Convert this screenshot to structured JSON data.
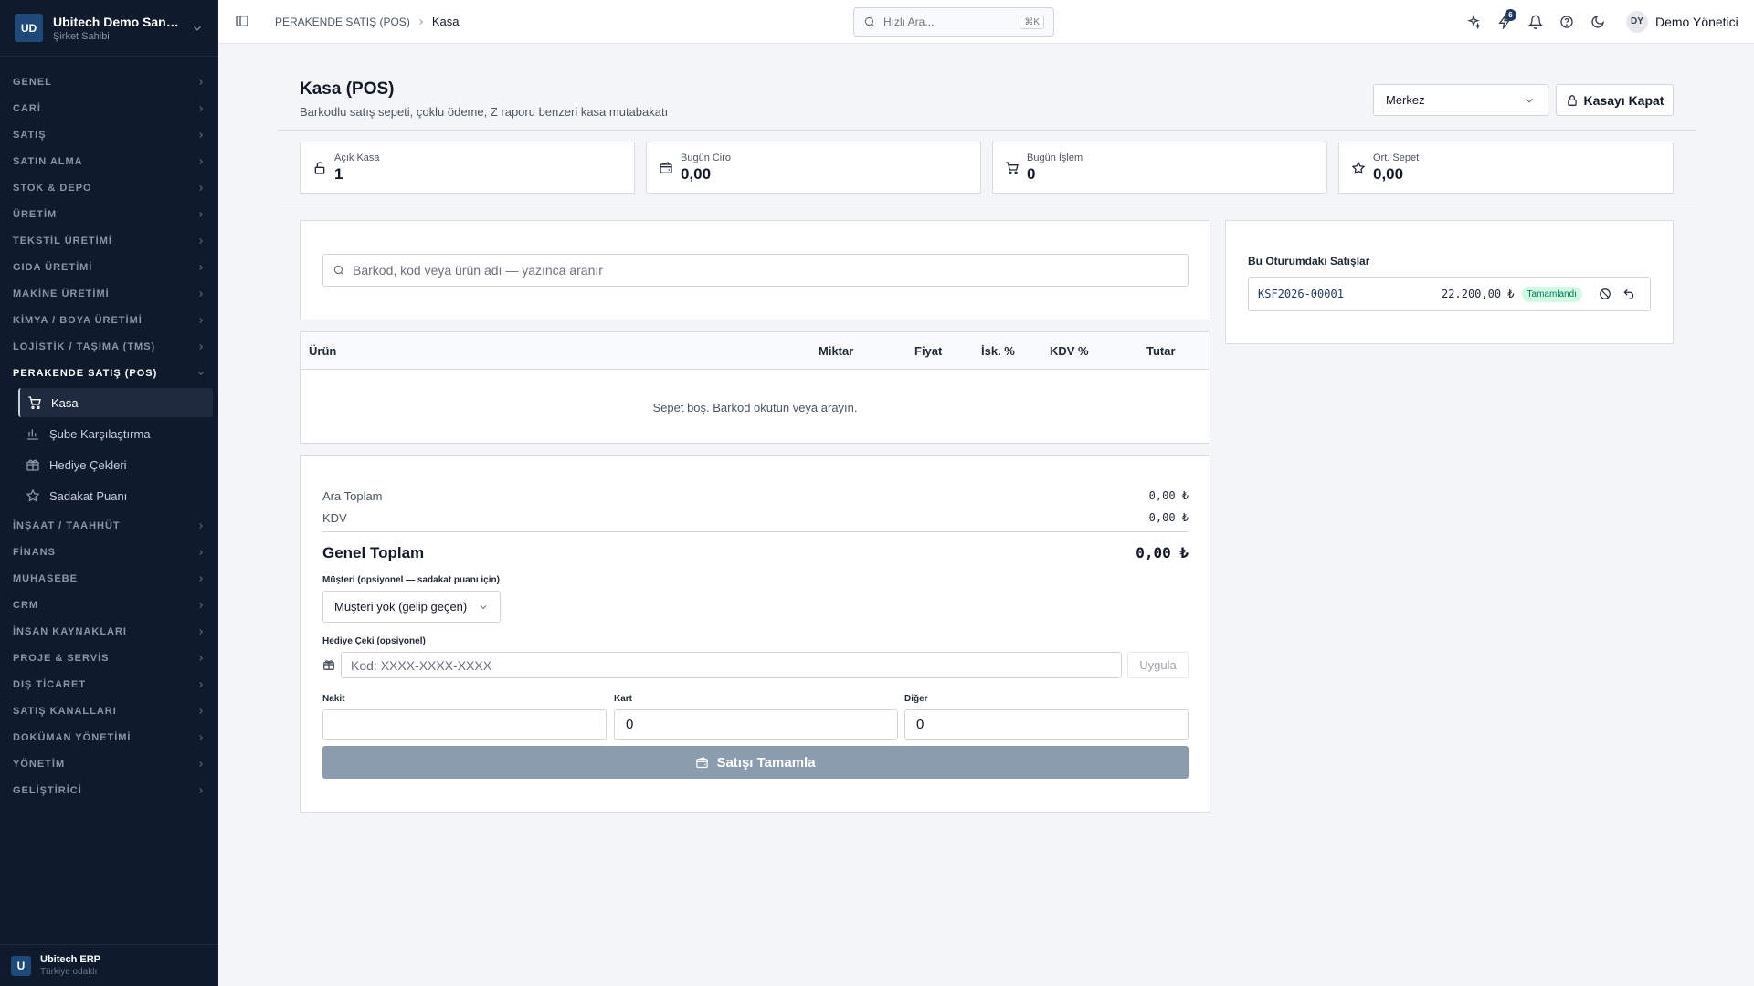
{
  "org": {
    "initials": "UD",
    "name": "Ubitech Demo Sana...",
    "role": "Şirket Sahibi"
  },
  "nav_before": [
    "GENEL",
    "CARİ",
    "SATIŞ",
    "SATIN ALMA",
    "STOK & DEPO",
    "ÜRETİM",
    "TEKSTİL ÜRETİMİ",
    "GIDA ÜRETİMİ",
    "MAKİNE ÜRETİMİ",
    "KİMYA / BOYA ÜRETİMİ",
    "LOJİSTİK / TAŞIMA (TMS)"
  ],
  "nav_open": "PERAKENDE SATIŞ (POS)",
  "nav_sub": [
    "Kasa",
    "Şube Karşılaştırma",
    "Hediye Çekleri",
    "Sadakat Puanı"
  ],
  "nav_after": [
    "İNŞAAT / TAAHHÜT",
    "FİNANS",
    "MUHASEBE",
    "CRM",
    "İNSAN KAYNAKLARI",
    "PROJE & SERVİS",
    "DIŞ TİCARET",
    "SATIŞ KANALLARI",
    "DOKÜMAN YÖNETİMİ",
    "YÖNETİM",
    "GELİŞTİRİCİ"
  ],
  "footer": {
    "initial": "U",
    "title": "Ubitech ERP",
    "subtitle": "Türkiye odaklı"
  },
  "topbar": {
    "breadcrumb_parent": "PERAKENDE SATIŞ (POS)",
    "breadcrumb_current": "Kasa",
    "search_placeholder": "Hızlı Ara...",
    "search_shortcut": "⌘K",
    "notif_badge": "6",
    "user_initials": "DY",
    "user_name": "Demo Yönetici"
  },
  "page": {
    "title": "Kasa (POS)",
    "subtitle": "Barkodlu satış sepeti, çoklu ödeme, Z raporu benzeri kasa mutabakatı",
    "branch": "Merkez",
    "close_label": "Kasayı Kapat"
  },
  "stats": [
    {
      "label": "Açık Kasa",
      "value": "1"
    },
    {
      "label": "Bugün Ciro",
      "value": "0,00"
    },
    {
      "label": "Bugün İşlem",
      "value": "0"
    },
    {
      "label": "Ort. Sepet",
      "value": "0,00"
    }
  ],
  "cart": {
    "search_placeholder": "Barkod, kod veya ürün adı — yazınca aranır",
    "columns": [
      "Ürün",
      "Miktar",
      "Fiyat",
      "İsk. %",
      "KDV %",
      "Tutar"
    ],
    "empty_message": "Sepet boş. Barkod okutun veya arayın."
  },
  "totals": {
    "subtotal_label": "Ara Toplam",
    "subtotal_value": "0,00 ₺",
    "vat_label": "KDV",
    "vat_value": "0,00 ₺",
    "grand_label": "Genel Toplam",
    "grand_value": "0,00 ₺",
    "customer_label": "Müşteri (opsiyonel — sadakat puanı için)",
    "customer_value": "Müşteri yok (gelip geçen)",
    "gift_label": "Hediye Çeki (opsiyonel)",
    "gift_placeholder": "Kod: XXXX-XXXX-XXXX",
    "apply_label": "Uygula",
    "cash_label": "Nakit",
    "cash_value": "",
    "card_label": "Kart",
    "card_value": "0",
    "other_label": "Diğer",
    "other_value": "0",
    "complete_label": "Satışı Tamamla"
  },
  "session": {
    "title": "Bu Oturumdaki Satışlar",
    "sales": [
      {
        "number": "KSF2026-00001",
        "amount": "22.200,00 ₺",
        "status": "Tamamlandı"
      }
    ]
  }
}
